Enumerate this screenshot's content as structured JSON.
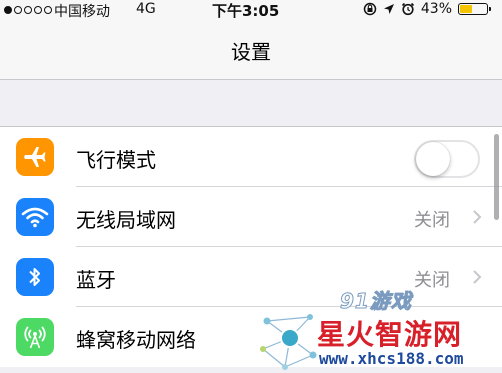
{
  "status_bar": {
    "carrier": "中国移动",
    "network": "4G",
    "time": "下午3:05",
    "battery_percent_label": "43%",
    "battery_level": 0.43,
    "icons": [
      "lock-rotation-icon",
      "location-arrow-icon",
      "alarm-icon",
      "battery-icon"
    ]
  },
  "nav": {
    "title": "设置"
  },
  "settings": {
    "items": [
      {
        "label": "飞行模式",
        "icon": "airplane-icon",
        "icon_color": "#ff9500",
        "control": "toggle",
        "toggle_on": false
      },
      {
        "label": "无线局域网",
        "icon": "wifi-icon",
        "icon_color": "#1a82fb",
        "value": "关闭",
        "control": "chevron"
      },
      {
        "label": "蓝牙",
        "icon": "bluetooth-icon",
        "icon_color": "#1a82fb",
        "value": "关闭",
        "control": "chevron"
      },
      {
        "label": "蜂窝移动网络",
        "icon": "cellular-antenna-icon",
        "icon_color": "#4cd964"
      }
    ]
  },
  "watermark": {
    "logo_small": "91游戏",
    "brand": "星火智游网",
    "url": "www.xhcs188.com"
  }
}
